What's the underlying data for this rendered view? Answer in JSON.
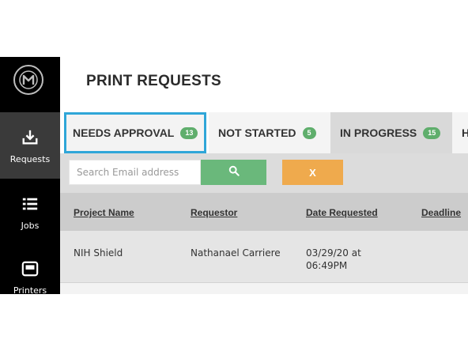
{
  "sidebar": {
    "logo_icon": "makerbot-m-logo",
    "items": [
      {
        "label": "Requests",
        "icon": "download-tray-icon",
        "active": true
      },
      {
        "label": "Jobs",
        "icon": "list-icon",
        "active": false
      },
      {
        "label": "Printers",
        "icon": "printer-icon",
        "active": false
      }
    ]
  },
  "header": {
    "title": "PRINT REQUESTS"
  },
  "tabs": [
    {
      "label": "NEEDS APPROVAL",
      "count": "13"
    },
    {
      "label": "NOT STARTED",
      "count": "5"
    },
    {
      "label": "IN PROGRESS",
      "count": "15"
    },
    {
      "label": "H"
    }
  ],
  "filter": {
    "search_placeholder": "Search Email address",
    "clear_label": "X"
  },
  "table": {
    "headers": [
      "Project Name",
      "Requestor",
      "Date Requested",
      "Deadline"
    ],
    "rows": [
      {
        "project": "NIH Shield",
        "requestor": "Nathanael Carriere",
        "date": "03/29/20 at 06:49PM"
      }
    ]
  },
  "colors": {
    "accent_blue": "#2fa6d8",
    "badge_green": "#5fae6c",
    "search_green": "#6ab87b",
    "clear_orange": "#efaa4d",
    "sidebar_black": "#000000"
  }
}
